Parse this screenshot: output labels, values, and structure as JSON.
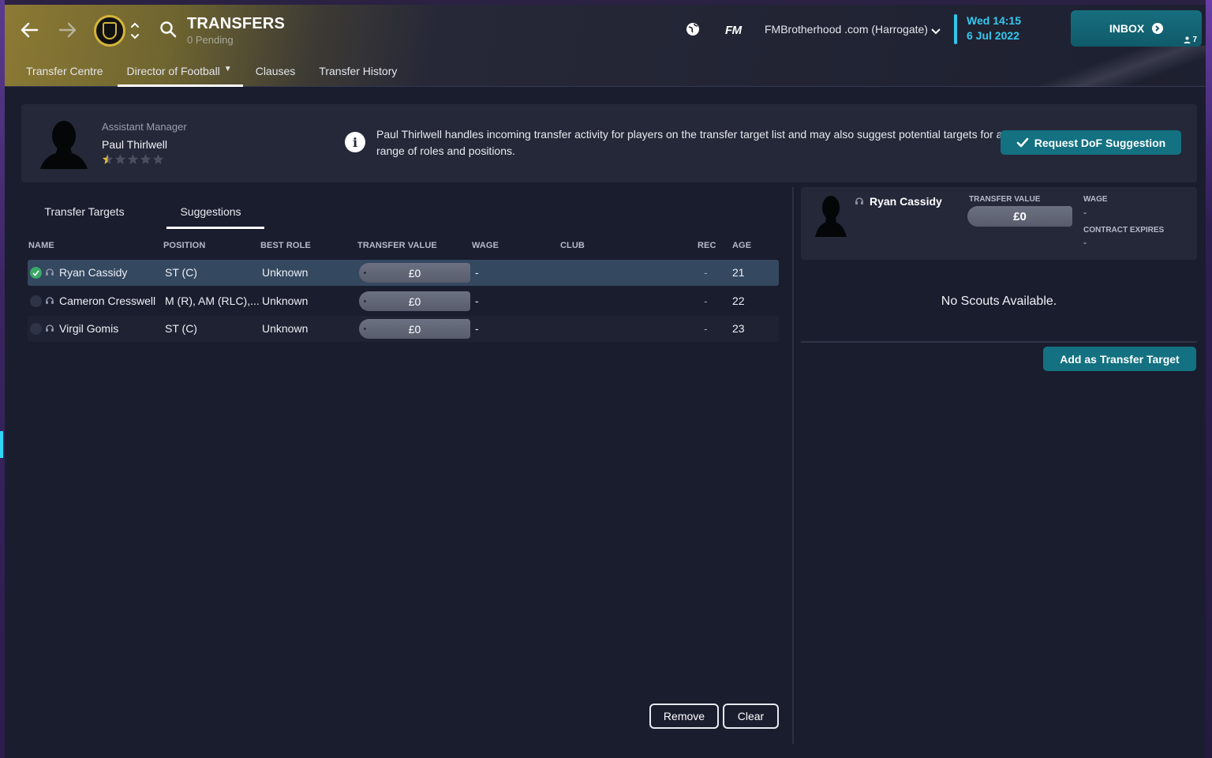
{
  "header": {
    "title": "TRANSFERS",
    "subtitle": "0 Pending",
    "tabs": [
      {
        "label": "Transfer Centre"
      },
      {
        "label": "Director of Football"
      },
      {
        "label": "Clauses"
      },
      {
        "label": "Transfer History"
      }
    ],
    "fm_logo": "FM",
    "save_name": "FMBrotherhood .com (Harrogate)",
    "date_line1": "Wed 14:15",
    "date_line2": "6 Jul 2022",
    "inbox_label": "INBOX",
    "inbox_count": "7"
  },
  "dof": {
    "role": "Assistant Manager",
    "name": "Paul Thirlwell",
    "rating_stars": 0.5,
    "max_stars": 5,
    "info_text": "Paul Thirlwell handles incoming transfer activity for players on the transfer target list and may also suggest potential targets for a range of roles and positions.",
    "request_button": "Request DoF Suggestion"
  },
  "list": {
    "tabs": [
      {
        "label": "Transfer Targets"
      },
      {
        "label": "Suggestions"
      }
    ],
    "columns": {
      "name": "NAME",
      "position": "POSITION",
      "best_role": "BEST ROLE",
      "transfer_value": "TRANSFER VALUE",
      "wage": "WAGE",
      "club": "CLUB",
      "rec": "REC",
      "age": "AGE"
    },
    "rows": [
      {
        "name": "Ryan Cassidy",
        "position": "ST (C)",
        "best_role": "Unknown",
        "transfer_value": "£0",
        "wage": "-",
        "club": "",
        "rec": "-",
        "age": "21",
        "selected": true
      },
      {
        "name": "Cameron Cresswell",
        "position": "M (R), AM (RLC),...",
        "best_role": "Unknown",
        "transfer_value": "£0",
        "wage": "-",
        "club": "",
        "rec": "-",
        "age": "22",
        "selected": false
      },
      {
        "name": "Virgil Gomis",
        "position": "ST (C)",
        "best_role": "Unknown",
        "transfer_value": "£0",
        "wage": "-",
        "club": "",
        "rec": "-",
        "age": "23",
        "selected": false
      }
    ],
    "remove_button": "Remove",
    "clear_button": "Clear"
  },
  "detail": {
    "player_name": "Ryan Cassidy",
    "transfer_value_label": "TRANSFER VALUE",
    "transfer_value": "£0",
    "wage_label": "WAGE",
    "wage": "-",
    "contract_label": "CONTRACT EXPIRES",
    "contract": "-",
    "no_scouts": "No Scouts Available.",
    "add_button": "Add as Transfer Target"
  },
  "colors": {
    "background": "#1a1d2e",
    "card": "#242839",
    "accent_teal": "#137181",
    "date_cyan": "#35c9ee",
    "selected_row": "#344860",
    "check_green": "#3aa866",
    "star_gold": "#e2b93b"
  }
}
